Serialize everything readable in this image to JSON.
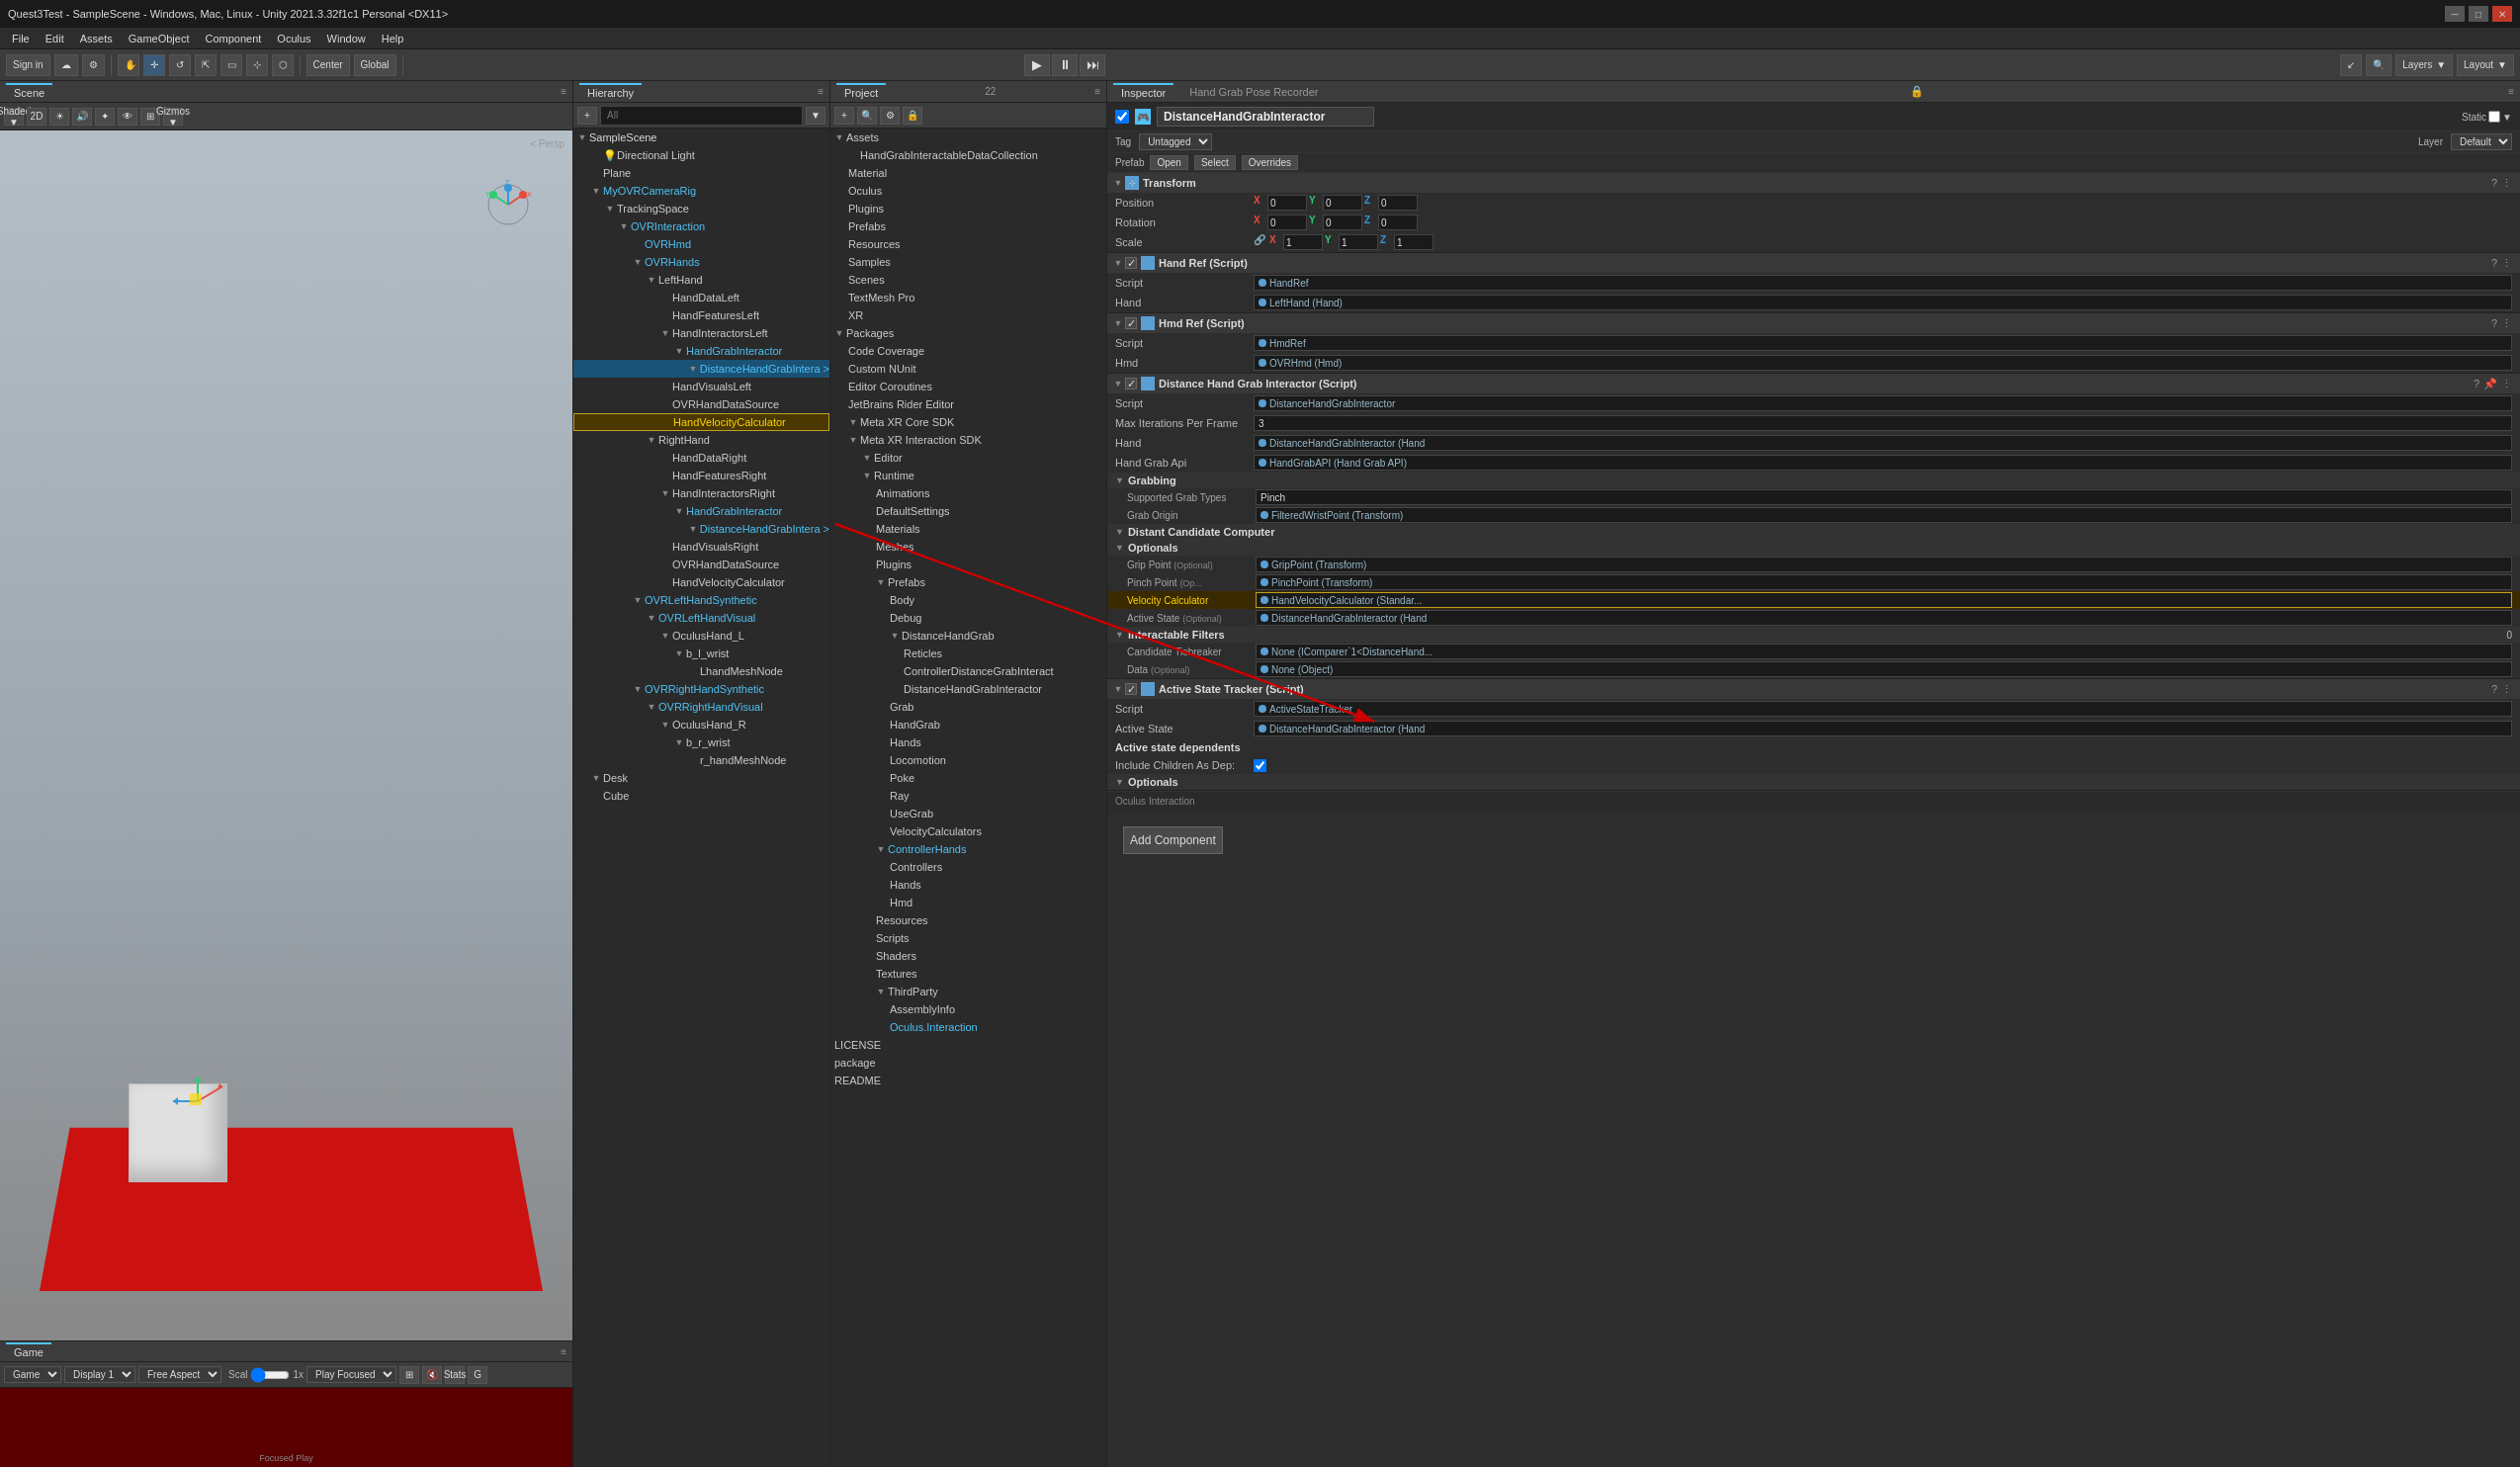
{
  "titleBar": {
    "title": "Quest3Test - SampleScene - Windows, Mac, Linux - Unity 2021.3.32f1c1 Personal <DX11>",
    "winControls": [
      "_",
      "□",
      "✕"
    ]
  },
  "menuBar": {
    "items": [
      "File",
      "Edit",
      "Assets",
      "GameObject",
      "Component",
      "Oculus",
      "Window",
      "Help"
    ]
  },
  "topToolbar": {
    "signIn": "Sign in",
    "layers": "Layers",
    "layout": "Layout"
  },
  "scenePanels": {
    "sceneTab": "Scene",
    "gameTab": "Game",
    "sceneLabel": "< Persp"
  },
  "hierarchy": {
    "tab": "Hierarchy",
    "searchPlaceholder": "All",
    "items": [
      {
        "label": "SampleScene",
        "indent": 0,
        "arrow": "▼",
        "icon": "📄"
      },
      {
        "label": "Directional Light",
        "indent": 1,
        "arrow": "",
        "icon": "💡"
      },
      {
        "label": "Plane",
        "indent": 1,
        "arrow": "",
        "icon": "▭"
      },
      {
        "label": "MyOVRCameraRig",
        "indent": 1,
        "arrow": "▼",
        "icon": "📷",
        "color": "blue"
      },
      {
        "label": "TrackingSpace",
        "indent": 2,
        "arrow": "▼",
        "icon": "📁"
      },
      {
        "label": "OVRInteraction",
        "indent": 3,
        "arrow": "▼",
        "icon": "📁",
        "color": "blue"
      },
      {
        "label": "OVRHmd",
        "indent": 4,
        "arrow": "",
        "icon": "📁",
        "color": "blue"
      },
      {
        "label": "OVRHands",
        "indent": 4,
        "arrow": "▼",
        "icon": "📁",
        "color": "blue"
      },
      {
        "label": "LeftHand",
        "indent": 5,
        "arrow": "▼",
        "icon": "📁"
      },
      {
        "label": "HandDataLeft",
        "indent": 6,
        "arrow": "",
        "icon": "📁"
      },
      {
        "label": "HandFeaturesLeft",
        "indent": 6,
        "arrow": "",
        "icon": "📁"
      },
      {
        "label": "HandInteractorsLeft",
        "indent": 6,
        "arrow": "▼",
        "icon": "📁"
      },
      {
        "label": "HandGrabInteractor",
        "indent": 7,
        "arrow": "▼",
        "icon": "📁",
        "color": "blue"
      },
      {
        "label": "DistanceHandGrabIntera >",
        "indent": 8,
        "arrow": "▼",
        "icon": "📁",
        "color": "blue"
      },
      {
        "label": "HandVisualsLeft",
        "indent": 6,
        "arrow": "",
        "icon": "📁"
      },
      {
        "label": "OVRHandDataSource",
        "indent": 6,
        "arrow": "",
        "icon": "📁"
      },
      {
        "label": "HandVelocityCalculator",
        "indent": 6,
        "arrow": "",
        "icon": "📁",
        "highlighted": true
      },
      {
        "label": "RightHand",
        "indent": 5,
        "arrow": "▼",
        "icon": "📁"
      },
      {
        "label": "HandDataRight",
        "indent": 6,
        "arrow": "",
        "icon": "📁"
      },
      {
        "label": "HandFeaturesRight",
        "indent": 6,
        "arrow": "",
        "icon": "📁"
      },
      {
        "label": "HandInteractorsRight",
        "indent": 6,
        "arrow": "▼",
        "icon": "📁"
      },
      {
        "label": "HandGrabInteractor",
        "indent": 7,
        "arrow": "▼",
        "icon": "📁",
        "color": "blue"
      },
      {
        "label": "DistanceHandGrabIntera >",
        "indent": 8,
        "arrow": "▼",
        "icon": "📁",
        "color": "blue"
      },
      {
        "label": "HandVisualsRight",
        "indent": 6,
        "arrow": "",
        "icon": "📁"
      },
      {
        "label": "OVRHandDataSource",
        "indent": 6,
        "arrow": "",
        "icon": "📁"
      },
      {
        "label": "HandVelocityCalculator",
        "indent": 6,
        "arrow": "",
        "icon": "📁"
      },
      {
        "label": "OVRLeftHandSynthetic",
        "indent": 4,
        "arrow": "▼",
        "icon": "📁",
        "color": "blue"
      },
      {
        "label": "OVRLeftHandVisual",
        "indent": 5,
        "arrow": "▼",
        "icon": "📁",
        "color": "blue"
      },
      {
        "label": "OculusHand_L",
        "indent": 6,
        "arrow": "▼",
        "icon": "📁"
      },
      {
        "label": "b_l_wrist",
        "indent": 7,
        "arrow": "▼",
        "icon": "📁"
      },
      {
        "label": "LhandMeshNode",
        "indent": 8,
        "arrow": "",
        "icon": "📁"
      },
      {
        "label": "OVRRightHandSynthetic",
        "indent": 4,
        "arrow": "▼",
        "icon": "📁",
        "color": "blue"
      },
      {
        "label": "OVRRightHandVisual",
        "indent": 5,
        "arrow": "▼",
        "icon": "📁",
        "color": "blue"
      },
      {
        "label": "OculusHand_R",
        "indent": 6,
        "arrow": "▼",
        "icon": "📁"
      },
      {
        "label": "b_r_wrist",
        "indent": 7,
        "arrow": "▼",
        "icon": "📁"
      },
      {
        "label": "r_handMeshNode",
        "indent": 8,
        "arrow": "",
        "icon": "📁"
      },
      {
        "label": "Desk",
        "indent": 1,
        "arrow": "▼",
        "icon": "📁"
      },
      {
        "label": "Cube",
        "indent": 1,
        "arrow": "",
        "icon": "📦"
      }
    ]
  },
  "project": {
    "tab": "Project",
    "items": [
      {
        "label": "Assets",
        "indent": 0,
        "arrow": "▼",
        "icon": "📁"
      },
      {
        "label": "HandGrabInteractableDataCollection",
        "indent": 1,
        "arrow": "",
        "icon": "📁"
      },
      {
        "label": "Material",
        "indent": 1,
        "arrow": "",
        "icon": "📁"
      },
      {
        "label": "Oculus",
        "indent": 1,
        "arrow": "",
        "icon": "📁"
      },
      {
        "label": "Plugins",
        "indent": 1,
        "arrow": "",
        "icon": "📁"
      },
      {
        "label": "Prefabs",
        "indent": 1,
        "arrow": "",
        "icon": "📁"
      },
      {
        "label": "Resources",
        "indent": 1,
        "arrow": "",
        "icon": "📁"
      },
      {
        "label": "Samples",
        "indent": 1,
        "arrow": "",
        "icon": "📁"
      },
      {
        "label": "Scenes",
        "indent": 1,
        "arrow": "",
        "icon": "📁"
      },
      {
        "label": "TextMesh Pro",
        "indent": 1,
        "arrow": "",
        "icon": "📁"
      },
      {
        "label": "XR",
        "indent": 1,
        "arrow": "",
        "icon": "📁"
      },
      {
        "label": "Packages",
        "indent": 0,
        "arrow": "▼",
        "icon": "📁"
      },
      {
        "label": "Code Coverage",
        "indent": 1,
        "arrow": "",
        "icon": "📁"
      },
      {
        "label": "Custom NUnit",
        "indent": 1,
        "arrow": "",
        "icon": "📁"
      },
      {
        "label": "Editor Coroutines",
        "indent": 1,
        "arrow": "",
        "icon": "📁"
      },
      {
        "label": "JetBrains Rider Editor",
        "indent": 1,
        "arrow": "",
        "icon": "📁"
      },
      {
        "label": "Meta XR Core SDK",
        "indent": 1,
        "arrow": "▼",
        "icon": "📁"
      },
      {
        "label": "Meta XR Interaction SDK",
        "indent": 1,
        "arrow": "▼",
        "icon": "📁"
      },
      {
        "label": "Editor",
        "indent": 2,
        "arrow": "▼",
        "icon": "📁"
      },
      {
        "label": "Runtime",
        "indent": 2,
        "arrow": "▼",
        "icon": "📁"
      },
      {
        "label": "Animations",
        "indent": 3,
        "arrow": "",
        "icon": "📁"
      },
      {
        "label": "DefaultSettings",
        "indent": 3,
        "arrow": "",
        "icon": "📁"
      },
      {
        "label": "Materials",
        "indent": 3,
        "arrow": "",
        "icon": "📁"
      },
      {
        "label": "Meshes",
        "indent": 3,
        "arrow": "",
        "icon": "📁"
      },
      {
        "label": "Plugins",
        "indent": 3,
        "arrow": "",
        "icon": "📁"
      },
      {
        "label": "Prefabs",
        "indent": 3,
        "arrow": "▼",
        "icon": "📁"
      },
      {
        "label": "Body",
        "indent": 4,
        "arrow": "",
        "icon": "📁"
      },
      {
        "label": "Debug",
        "indent": 4,
        "arrow": "",
        "icon": "📁"
      },
      {
        "label": "DistanceHandGrab",
        "indent": 4,
        "arrow": "▼",
        "icon": "📁"
      },
      {
        "label": "Reticles",
        "indent": 5,
        "arrow": "",
        "icon": "📁"
      },
      {
        "label": "ControllerDistanceGrabInteract",
        "indent": 5,
        "arrow": "",
        "icon": "📁"
      },
      {
        "label": "DistanceHandGrabInteractor",
        "indent": 5,
        "arrow": "",
        "icon": "📁"
      },
      {
        "label": "Grab",
        "indent": 4,
        "arrow": "",
        "icon": "📁"
      },
      {
        "label": "HandGrab",
        "indent": 4,
        "arrow": "",
        "icon": "📁"
      },
      {
        "label": "Hands",
        "indent": 4,
        "arrow": "",
        "icon": "📁"
      },
      {
        "label": "Locomotion",
        "indent": 4,
        "arrow": "",
        "icon": "📁"
      },
      {
        "label": "Poke",
        "indent": 4,
        "arrow": "",
        "icon": "📁"
      },
      {
        "label": "Ray",
        "indent": 4,
        "arrow": "",
        "icon": "📁"
      },
      {
        "label": "UseGrab",
        "indent": 4,
        "arrow": "",
        "icon": "📁"
      },
      {
        "label": "VelocityCalculators",
        "indent": 4,
        "arrow": "",
        "icon": "📁"
      },
      {
        "label": "ControllerHands",
        "indent": 3,
        "arrow": "▼",
        "icon": "📁",
        "color": "blue"
      },
      {
        "label": "Controllers",
        "indent": 4,
        "arrow": "",
        "icon": "📁"
      },
      {
        "label": "Hands",
        "indent": 4,
        "arrow": "",
        "icon": "📁"
      },
      {
        "label": "Hmd",
        "indent": 4,
        "arrow": "",
        "icon": "📁"
      },
      {
        "label": "Resources",
        "indent": 3,
        "arrow": "",
        "icon": "📁"
      },
      {
        "label": "Scripts",
        "indent": 3,
        "arrow": "",
        "icon": "📁"
      },
      {
        "label": "Shaders",
        "indent": 3,
        "arrow": "",
        "icon": "📁"
      },
      {
        "label": "Textures",
        "indent": 3,
        "arrow": "",
        "icon": "📁"
      },
      {
        "label": "ThirdParty",
        "indent": 3,
        "arrow": "",
        "icon": "📁"
      },
      {
        "label": "AssemblyInfo",
        "indent": 4,
        "arrow": "",
        "icon": "📄"
      },
      {
        "label": "Oculus.Interaction",
        "indent": 4,
        "arrow": "",
        "icon": "📄"
      },
      {
        "label": "LICENSE",
        "indent": 0,
        "arrow": "",
        "icon": "📄"
      },
      {
        "label": "package",
        "indent": 0,
        "arrow": "",
        "icon": "📄"
      },
      {
        "label": "README",
        "indent": 0,
        "arrow": "",
        "icon": "📄"
      }
    ]
  },
  "inspector": {
    "tab": "Inspector",
    "tab2": "Hand Grab Pose Recorder",
    "objectName": "DistanceHandGrabInteractor",
    "static": "Static",
    "tag": "Untagged",
    "layer": "Default",
    "prefab": "Prefab",
    "open": "Open",
    "select": "Select",
    "overrides": "Overrides",
    "transform": {
      "title": "Transform",
      "position": "Position",
      "rotation": "Rotation",
      "scale": "Scale",
      "x": "0",
      "y": "0",
      "z": "0",
      "rx": "0",
      "ry": "0",
      "rz": "0",
      "sx": "1",
      "sy": "1",
      "sz": "1"
    },
    "handRef": {
      "title": "Hand Ref (Script)",
      "script": "HandRef",
      "handLabel": "Hand",
      "handValue": "LeftHand (Hand)"
    },
    "hmdRef": {
      "title": "Hmd Ref (Script)",
      "script": "HmdRef",
      "hmdLabel": "Hmd",
      "hmdValue": "OVRHmd (Hmd)"
    },
    "distanceGrab": {
      "title": "Distance Hand Grab Interactor (Script)",
      "script": "DistanceHandGrabInteractor",
      "maxIterations": "Max Iterations Per Frame",
      "maxIterationsValue": "3",
      "hand": "Hand",
      "handValue": "DistanceHandGrabInteractor (Hand",
      "handGrabApi": "Hand Grab Api",
      "handGrabApiValue": "HandGrabAPI (Hand Grab API)",
      "grabbing": "Grabbing",
      "supportedGrabTypes": "Supported Grab Types",
      "supportedGrabTypesValue": "Pinch",
      "grabOrigin": "Grab Origin",
      "grabOriginValue": "FilteredWristPoint (Transform)",
      "distantCandidate": "Distant Candidate Computer",
      "optionals": "Optionals",
      "gripPoint": "Grip Point",
      "gripPointOptional": "(Optional)",
      "gripPointValue": "GripPoint (Transform)",
      "pinchPoint": "Pinch Point",
      "pinchPointOptional": "(Op...",
      "pinchPointValue": "PinchPoint (Transform)",
      "velocityCalculator": "Velocity Calculator",
      "velocityCalculatorValue": "HandVelocityCalculator (Standar...",
      "activeState": "Active State",
      "activeStateOptional": "(Optional)",
      "activeStateValue": "DistanceHandGrabInteractor (Hand",
      "interactableFilters": "Interactable Filters",
      "interactableFiltersValue": "0",
      "candidateTiebreaker": "Candidate Tiebreaker",
      "candidateTiebreakerValue": "None (IComparer`1<DistanceHand...",
      "data": "Data",
      "dataOptional": "(Optional)",
      "dataValue": "None (Object)"
    },
    "activeStateTracker": {
      "title": "Active State Tracker (Script)",
      "script": "ActiveStateTracker",
      "activeState": "Active State",
      "activeStateValue": "DistanceHandGrabInteractor (Hand",
      "activeStateDependents": "Active state dependents",
      "includeChildren": "Include Children As Dep:",
      "optionals": "Optionals"
    },
    "addComponent": "Add Component",
    "ocolusInteraction": "Oculus Interaction"
  },
  "gameBar": {
    "game": "Game",
    "display": "Display 1",
    "aspect": "Free Aspect",
    "scale": "Scal",
    "scaleValue": "1x",
    "playFocused": "Play Focused",
    "stats": "Stats",
    "g": "G",
    "focusedPlay": "Focused Play"
  }
}
